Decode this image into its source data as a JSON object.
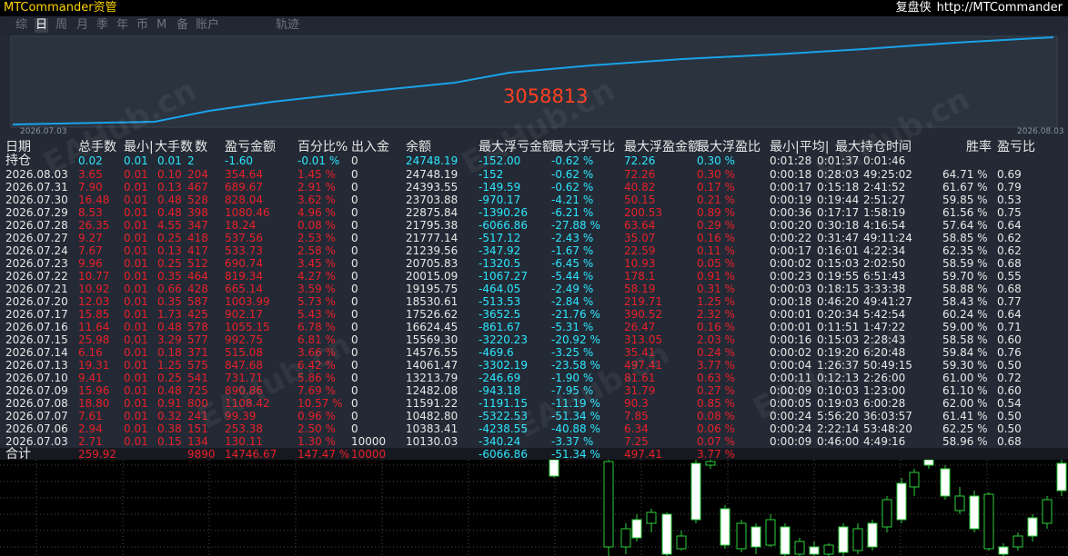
{
  "header": {
    "app_title": "MTCommander资管",
    "right_label": "复盘侠",
    "url": "http://MTCommander"
  },
  "tabs": [
    {
      "label": "综",
      "active": false
    },
    {
      "label": "日",
      "active": true
    },
    {
      "label": "周",
      "active": false
    },
    {
      "label": "月",
      "active": false
    },
    {
      "label": "季",
      "active": false
    },
    {
      "label": "年",
      "active": false
    },
    {
      "label": "币",
      "active": false
    },
    {
      "label": "M",
      "active": false
    },
    {
      "label": "备",
      "active": false
    },
    {
      "label": "账户",
      "active": false
    },
    {
      "label": "轨迹",
      "active": false
    }
  ],
  "equity_chart": {
    "value_label": "3058813",
    "start_date": "2026.07.03",
    "end_date": "2026.08.03",
    "line_color": "#1aa3e8"
  },
  "table": {
    "headers": [
      "日期",
      "总手数",
      "最小|",
      "大手数",
      "数",
      "盈亏金额",
      "百分比%",
      "出入金",
      "余额",
      "最大浮亏金额",
      "最大浮亏比",
      "最大浮盈金额",
      "最大浮盈比",
      "最小|平均|",
      "最大持仓时间",
      "胜率",
      "盈亏比"
    ],
    "position_row": [
      "持仓",
      "0.02",
      "0.01",
      "0.01",
      "2",
      "-1.60",
      "-0.01 %",
      "0",
      "24748.19",
      "-152.00",
      "-0.62 %",
      "72.26",
      "0.30 %",
      "0:01:28",
      "0:01:37",
      "0:01:46",
      "",
      ""
    ],
    "rows": [
      [
        "2026.08.03",
        "3.65",
        "0.01",
        "0.10",
        "204",
        "354.64",
        "1.45 %",
        "0",
        "24748.19",
        "-152",
        "-0.62 %",
        "72.26",
        "0.30 %",
        "0:00:18",
        "0:28:03",
        "49:25:02",
        "64.71 %",
        "0.69"
      ],
      [
        "2026.07.31",
        "7.90",
        "0.01",
        "0.13",
        "467",
        "689.67",
        "2.91 %",
        "0",
        "24393.55",
        "-149.59",
        "-0.62 %",
        "40.82",
        "0.17 %",
        "0:00:17",
        "0:15:18",
        "2:41:52",
        "61.67 %",
        "0.79"
      ],
      [
        "2026.07.30",
        "16.48",
        "0.01",
        "0.48",
        "528",
        "828.04",
        "3.62 %",
        "0",
        "23703.88",
        "-970.17",
        "-4.21 %",
        "50.15",
        "0.21 %",
        "0:00:19",
        "0:19:44",
        "2:51:27",
        "59.85 %",
        "0.53"
      ],
      [
        "2026.07.29",
        "8.53",
        "0.01",
        "0.48",
        "398",
        "1080.46",
        "4.96 %",
        "0",
        "22875.84",
        "-1390.26",
        "-6.21 %",
        "200.53",
        "0.89 %",
        "0:00:36",
        "0:17:17",
        "1:58:19",
        "61.56 %",
        "0.75"
      ],
      [
        "2026.07.28",
        "26.35",
        "0.01",
        "4.55",
        "347",
        "18.24",
        "0.08 %",
        "0",
        "21795.38",
        "-6066.86",
        "-27.88 %",
        "63.64",
        "0.29 %",
        "0:00:20",
        "0:30:18",
        "4:16:54",
        "57.64 %",
        "0.64"
      ],
      [
        "2026.07.27",
        "9.27",
        "0.01",
        "0.25",
        "418",
        "537.56",
        "2.53 %",
        "0",
        "21777.14",
        "-517.12",
        "-2.43 %",
        "35.07",
        "0.16 %",
        "0:00:22",
        "0:31:47",
        "49:11:24",
        "58.85 %",
        "0.62"
      ],
      [
        "2026.07.24",
        "7.67",
        "0.01",
        "0.13",
        "417",
        "533.73",
        "2.58 %",
        "0",
        "21239.56",
        "-347.92",
        "-1.67 %",
        "22.59",
        "0.11 %",
        "0:00:17",
        "0:16:01",
        "4:22:34",
        "62.35 %",
        "0.62"
      ],
      [
        "2026.07.23",
        "9.96",
        "0.01",
        "0.25",
        "512",
        "690.74",
        "3.45 %",
        "0",
        "20705.83",
        "-1320.5",
        "-6.45 %",
        "10.93",
        "0.05 %",
        "0:00:02",
        "0:15:03",
        "2:02:50",
        "58.59 %",
        "0.68"
      ],
      [
        "2026.07.22",
        "10.77",
        "0.01",
        "0.35",
        "464",
        "819.34",
        "4.27 %",
        "0",
        "20015.09",
        "-1067.27",
        "-5.44 %",
        "178.1",
        "0.91 %",
        "0:00:23",
        "0:19:55",
        "6:51:43",
        "59.70 %",
        "0.55"
      ],
      [
        "2026.07.21",
        "10.92",
        "0.01",
        "0.66",
        "428",
        "665.14",
        "3.59 %",
        "0",
        "19195.75",
        "-464.05",
        "-2.49 %",
        "58.19",
        "0.31 %",
        "0:00:03",
        "0:18:15",
        "3:33:38",
        "58.88 %",
        "0.68"
      ],
      [
        "2026.07.20",
        "12.03",
        "0.01",
        "0.35",
        "587",
        "1003.99",
        "5.73 %",
        "0",
        "18530.61",
        "-513.53",
        "-2.84 %",
        "219.71",
        "1.25 %",
        "0:00:18",
        "0:46:20",
        "49:41:27",
        "58.43 %",
        "0.77"
      ],
      [
        "2026.07.17",
        "15.85",
        "0.01",
        "1.73",
        "425",
        "902.17",
        "5.43 %",
        "0",
        "17526.62",
        "-3652.5",
        "-21.76 %",
        "390.52",
        "2.32 %",
        "0:00:01",
        "0:20:34",
        "5:42:54",
        "60.24 %",
        "0.64"
      ],
      [
        "2026.07.16",
        "11.64",
        "0.01",
        "0.48",
        "578",
        "1055.15",
        "6.78 %",
        "0",
        "16624.45",
        "-861.67",
        "-5.31 %",
        "26.47",
        "0.16 %",
        "0:00:01",
        "0:11:51",
        "1:47:22",
        "59.00 %",
        "0.71"
      ],
      [
        "2026.07.15",
        "25.98",
        "0.01",
        "3.29",
        "577",
        "992.75",
        "6.81 %",
        "0",
        "15569.30",
        "-3220.23",
        "-20.92 %",
        "313.05",
        "2.03 %",
        "0:00:16",
        "0:15:03",
        "2:28:43",
        "58.58 %",
        "0.60"
      ],
      [
        "2026.07.14",
        "6.16",
        "0.01",
        "0.18",
        "371",
        "515.08",
        "3.66 %",
        "0",
        "14576.55",
        "-469.6",
        "-3.25 %",
        "35.41",
        "0.24 %",
        "0:00:02",
        "0:19:20",
        "6:20:48",
        "59.84 %",
        "0.76"
      ],
      [
        "2026.07.13",
        "19.31",
        "0.01",
        "1.25",
        "575",
        "847.68",
        "6.42 %",
        "0",
        "14061.47",
        "-3302.19",
        "-23.58 %",
        "497.41",
        "3.77 %",
        "0:00:04",
        "1:26:37",
        "50:49:15",
        "59.30 %",
        "0.50"
      ],
      [
        "2026.07.10",
        "9.41",
        "0.01",
        "0.25",
        "541",
        "731.71",
        "5.86 %",
        "0",
        "13213.79",
        "-246.69",
        "-1.90 %",
        "81.61",
        "0.63 %",
        "0:00:11",
        "0:12:13",
        "2:26:00",
        "61.00 %",
        "0.72"
      ],
      [
        "2026.07.09",
        "15.96",
        "0.01",
        "0.48",
        "725",
        "890.86",
        "7.69 %",
        "0",
        "12482.08",
        "-943.18",
        "-7.95 %",
        "31.79",
        "0.27 %",
        "0:00:09",
        "0:10:03",
        "1:23:00",
        "61.10 %",
        "0.60"
      ],
      [
        "2026.07.08",
        "18.80",
        "0.01",
        "0.91",
        "800",
        "1108.42",
        "10.57 %",
        "0",
        "11591.22",
        "-1191.15",
        "-11.19 %",
        "90.3",
        "0.85 %",
        "0:00:05",
        "0:19:03",
        "6:00:28",
        "62.00 %",
        "0.54"
      ],
      [
        "2026.07.07",
        "7.61",
        "0.01",
        "0.32",
        "241",
        "99.39",
        "0.96 %",
        "0",
        "10482.80",
        "-5322.53",
        "-51.34 %",
        "7.85",
        "0.08 %",
        "0:00:24",
        "5:56:20",
        "36:03:57",
        "61.41 %",
        "0.50"
      ],
      [
        "2026.07.06",
        "2.94",
        "0.01",
        "0.38",
        "151",
        "253.38",
        "2.50 %",
        "0",
        "10383.41",
        "-4238.55",
        "-40.88 %",
        "6.34",
        "0.06 %",
        "0:00:24",
        "2:22:14",
        "53:48:20",
        "62.25 %",
        "0.50"
      ],
      [
        "2026.07.03",
        "2.71",
        "0.01",
        "0.15",
        "134",
        "130.11",
        "1.30 %",
        "10000",
        "10130.03",
        "-340.24",
        "-3.37 %",
        "7.25",
        "0.07 %",
        "0:00:09",
        "0:46:00",
        "4:49:16",
        "58.96 %",
        "0.68"
      ]
    ],
    "total_row": [
      "合计",
      "259.92",
      "",
      "",
      "9890",
      "14746.67",
      "147.47 %",
      "10000",
      "",
      "-6066.86",
      "-51.34 %",
      "497.41",
      "3.77 %",
      "",
      "",
      "",
      "",
      ""
    ]
  },
  "colors": {
    "profit": "#e8202a",
    "cyan": "#2de6ff",
    "white": "#e8e8e8",
    "panel": "#232a35"
  },
  "watermark": "EAHub.cn"
}
